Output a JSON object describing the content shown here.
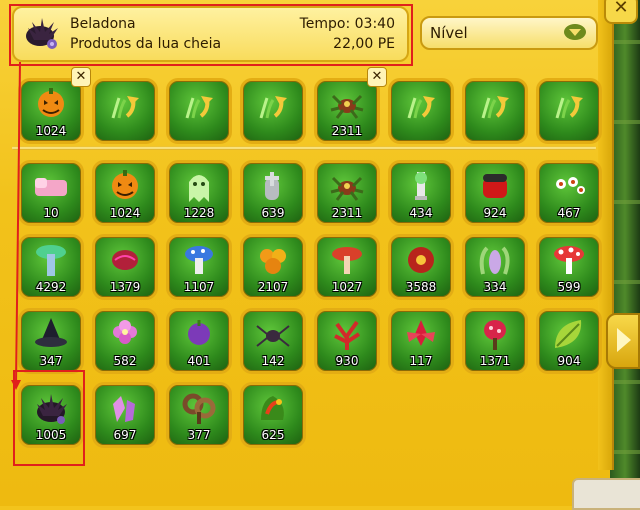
{
  "info": {
    "plant_name": "Beladona",
    "product_label": "Produtos da lua cheia",
    "time_label": "Tempo: 03:40",
    "price_label": "22,00 PE"
  },
  "level_select": {
    "label": "Nível"
  },
  "selected_row": [
    {
      "kind": "pumpkin",
      "count": "1024",
      "removable": true
    },
    {
      "kind": "empty-plant",
      "count": "",
      "removable": false
    },
    {
      "kind": "empty-plant",
      "count": "",
      "removable": false
    },
    {
      "kind": "empty-plant",
      "count": "",
      "removable": false
    },
    {
      "kind": "spider-plant",
      "count": "2311",
      "removable": true
    },
    {
      "kind": "empty-plant",
      "count": "",
      "removable": false
    },
    {
      "kind": "empty-plant",
      "count": "",
      "removable": false
    },
    {
      "kind": "empty-plant",
      "count": "",
      "removable": false
    }
  ],
  "inventory": [
    {
      "kind": "pink-bed",
      "count": "10"
    },
    {
      "kind": "pumpkin",
      "count": "1024"
    },
    {
      "kind": "ghost",
      "count": "1228"
    },
    {
      "kind": "tombstone",
      "count": "639"
    },
    {
      "kind": "spider-plant",
      "count": "2311"
    },
    {
      "kind": "skull-lamp",
      "count": "434"
    },
    {
      "kind": "red-box",
      "count": "924"
    },
    {
      "kind": "eyes",
      "count": "467"
    },
    {
      "kind": "tree",
      "count": "4292"
    },
    {
      "kind": "brain",
      "count": "1379"
    },
    {
      "kind": "blue-mushroom",
      "count": "1107"
    },
    {
      "kind": "orange-flower",
      "count": "2107"
    },
    {
      "kind": "red-mushroom",
      "count": "1027"
    },
    {
      "kind": "red-blossom",
      "count": "3588"
    },
    {
      "kind": "pitcher-plant",
      "count": "334"
    },
    {
      "kind": "spotted-mushroom",
      "count": "599"
    },
    {
      "kind": "witch-hat",
      "count": "347"
    },
    {
      "kind": "pink-flower",
      "count": "582"
    },
    {
      "kind": "purple-fruit",
      "count": "401"
    },
    {
      "kind": "spider",
      "count": "142"
    },
    {
      "kind": "red-coral",
      "count": "930"
    },
    {
      "kind": "red-lily",
      "count": "117"
    },
    {
      "kind": "red-berries",
      "count": "1371"
    },
    {
      "kind": "leaf",
      "count": "904"
    },
    {
      "kind": "belladonna",
      "count": "1005"
    },
    {
      "kind": "crystal",
      "count": "697"
    },
    {
      "kind": "brown-swirl",
      "count": "377"
    },
    {
      "kind": "fire-leaf",
      "count": "625"
    }
  ],
  "colors": {
    "panel": "#f3c41c",
    "slot_green": "#2e8a1c",
    "slot_border": "#e3ad14",
    "highlight_red": "#e0201c"
  }
}
